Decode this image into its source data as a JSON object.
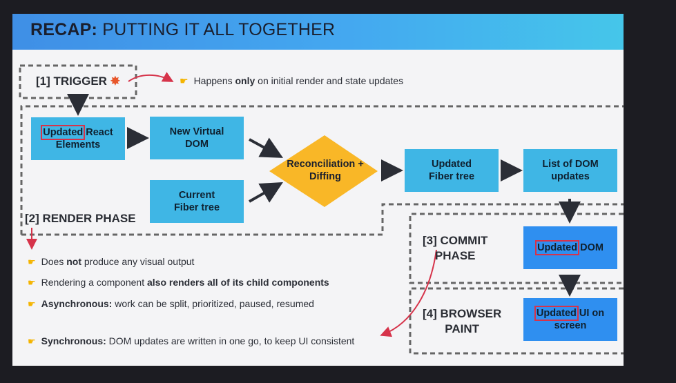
{
  "header": {
    "title_strong": "RECAP:",
    "title_rest": " PUTTING IT ALL TOGETHER"
  },
  "trigger": {
    "label": "[1] TRIGGER",
    "icon": "explosion-icon",
    "note_pre": "Happens ",
    "note_em": "only",
    "note_post": " on initial render and state updates"
  },
  "render": {
    "label": "[2] RENDER PHASE",
    "box_updated_hl": "Updated",
    "box_updated_rest": " React Elements",
    "box_new_vdom": "New Virtual DOM",
    "box_current_fiber": "Current Fiber tree",
    "diamond": "Reconciliation + Diffing",
    "box_updated_fiber": "Updated Fiber tree",
    "box_dom_updates": "List of DOM updates"
  },
  "commit": {
    "label_line1": "[3] COMMIT",
    "label_line2": "PHASE",
    "box_hl": "Updated",
    "box_rest": " DOM"
  },
  "paint": {
    "label_line1": "[4] BROWSER",
    "label_line2": "PAINT",
    "box_hl": "Updated",
    "box_rest": " UI on screen"
  },
  "bullets": [
    {
      "pre": "Does ",
      "em": "not",
      "post": " produce any visual output"
    },
    {
      "pre": "Rendering a component ",
      "em": "also renders all of its child components",
      "post": ""
    },
    {
      "pre": "",
      "em": "Asynchronous:",
      "post": " work can be split, prioritized, paused, resumed"
    },
    {
      "pre": "",
      "em": "Synchronous:",
      "post": " DOM updates are written in one go, to keep UI consistent"
    }
  ],
  "colors": {
    "box": "#3fb6e5",
    "box_dark": "#2f8ff0",
    "diamond": "#f9b727",
    "highlight": "#d6334a",
    "dash": "#666666"
  }
}
